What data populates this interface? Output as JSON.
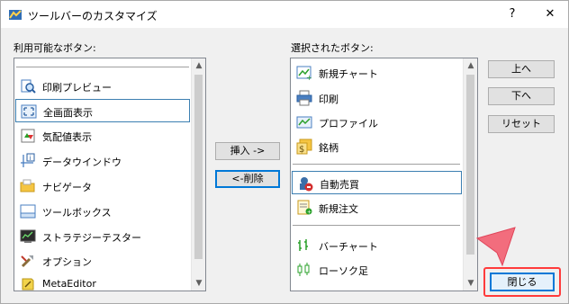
{
  "window": {
    "title": "ツールバーのカスタマイズ",
    "help_label": "?",
    "close_label": "✕"
  },
  "available": {
    "label": "利用可能なボタン:",
    "items": [
      {
        "label": "印刷プレビュー",
        "icon": "print-preview-icon"
      },
      {
        "label": "全画面表示",
        "icon": "fullscreen-icon",
        "selected": true
      },
      {
        "label": "気配値表示",
        "icon": "market-watch-icon"
      },
      {
        "label": "データウインドウ",
        "icon": "data-window-icon"
      },
      {
        "label": "ナビゲータ",
        "icon": "navigator-icon"
      },
      {
        "label": "ツールボックス",
        "icon": "toolbox-icon"
      },
      {
        "label": "ストラテジーテスター",
        "icon": "strategy-tester-icon"
      },
      {
        "label": "オプション",
        "icon": "options-icon"
      },
      {
        "label": "MetaEditor",
        "icon": "metaeditor-icon"
      }
    ]
  },
  "selected": {
    "label": "選択されたボタン:",
    "items": [
      {
        "label": "新規チャート",
        "icon": "new-chart-icon"
      },
      {
        "label": "印刷",
        "icon": "print-icon"
      },
      {
        "label": "プロファイル",
        "icon": "profile-icon"
      },
      {
        "label": "銘柄",
        "icon": "symbol-icon"
      },
      {
        "label": "自動売買",
        "icon": "auto-trading-icon",
        "selected": true
      },
      {
        "label": "新規注文",
        "icon": "new-order-icon"
      },
      {
        "label": "バーチャート",
        "icon": "bar-chart-icon"
      },
      {
        "label": "ローソク足",
        "icon": "candlestick-icon"
      }
    ]
  },
  "buttons": {
    "insert": "挿入 ->",
    "delete": "<-削除",
    "move_up": "上へ",
    "move_down": "下へ",
    "reset": "リセット",
    "close": "閉じる"
  },
  "colors": {
    "highlight_annotation": "#ff3b3b",
    "selection_border": "#3c7fb1"
  }
}
